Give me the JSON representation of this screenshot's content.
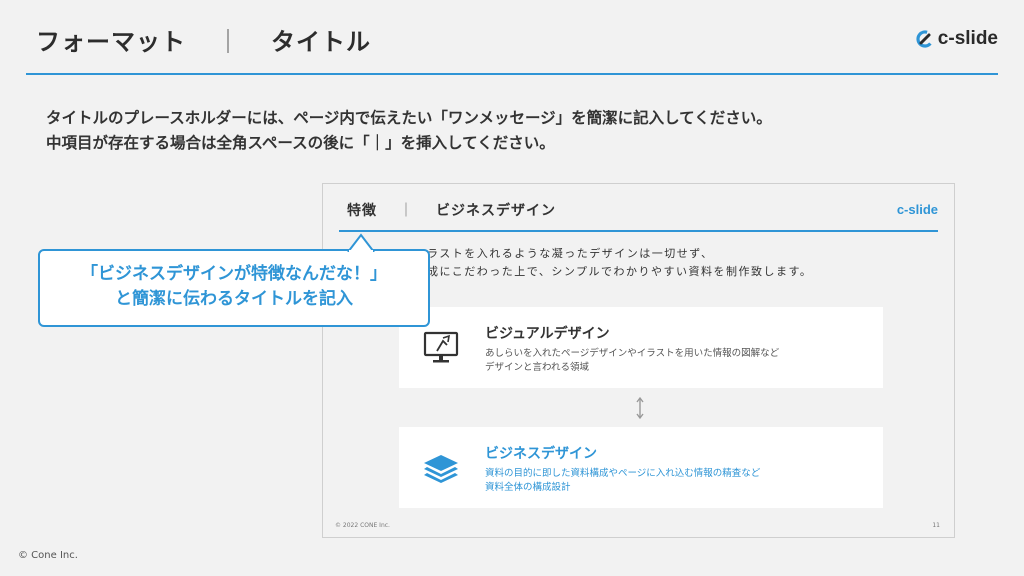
{
  "header": {
    "title_left": "フォーマット",
    "separator": "｜",
    "title_right": "タイトル",
    "logo_text": "c-slide"
  },
  "instructions": {
    "line1": "タイトルのプレースホルダーには、ページ内で伝えたい「ワンメッセージ」を簡潔に記入してください。",
    "line2": "中項目が存在する場合は全角スペースの後に「｜」を挿入してください。"
  },
  "preview": {
    "title_left": "特徴",
    "separator": "｜",
    "title_right": "ビジネスデザイン",
    "logo_text": "c-slide",
    "body_line1": "ラストを入れるような凝ったデザインは一切せず、",
    "body_line2": "成にこだわった上で、シンプルでわかりやすい資料を制作致します。",
    "cards": [
      {
        "title": "ビジュアルデザイン",
        "desc_line1": "あしらいを入れたページデザインやイラストを用いた情報の図解など",
        "desc_line2": "デザインと言われる領域",
        "icon": "monitor-icon"
      },
      {
        "title": "ビジネスデザイン",
        "desc_line1": "資料の目的に即した資料構成やページに入れ込む情報の精査など",
        "desc_line2": "資料全体の構成設計",
        "icon": "layers-icon"
      }
    ],
    "copyright": "© 2022 CONE Inc.",
    "page_number": "11"
  },
  "callout": {
    "line1": "「ビジネスデザインが特徴なんだな！」",
    "line2": "と簡潔に伝わるタイトルを記入"
  },
  "footer": {
    "copyright": "© Cone Inc."
  },
  "colors": {
    "accent": "#2f95d6",
    "background": "#f2f2f2",
    "text": "#333333"
  }
}
